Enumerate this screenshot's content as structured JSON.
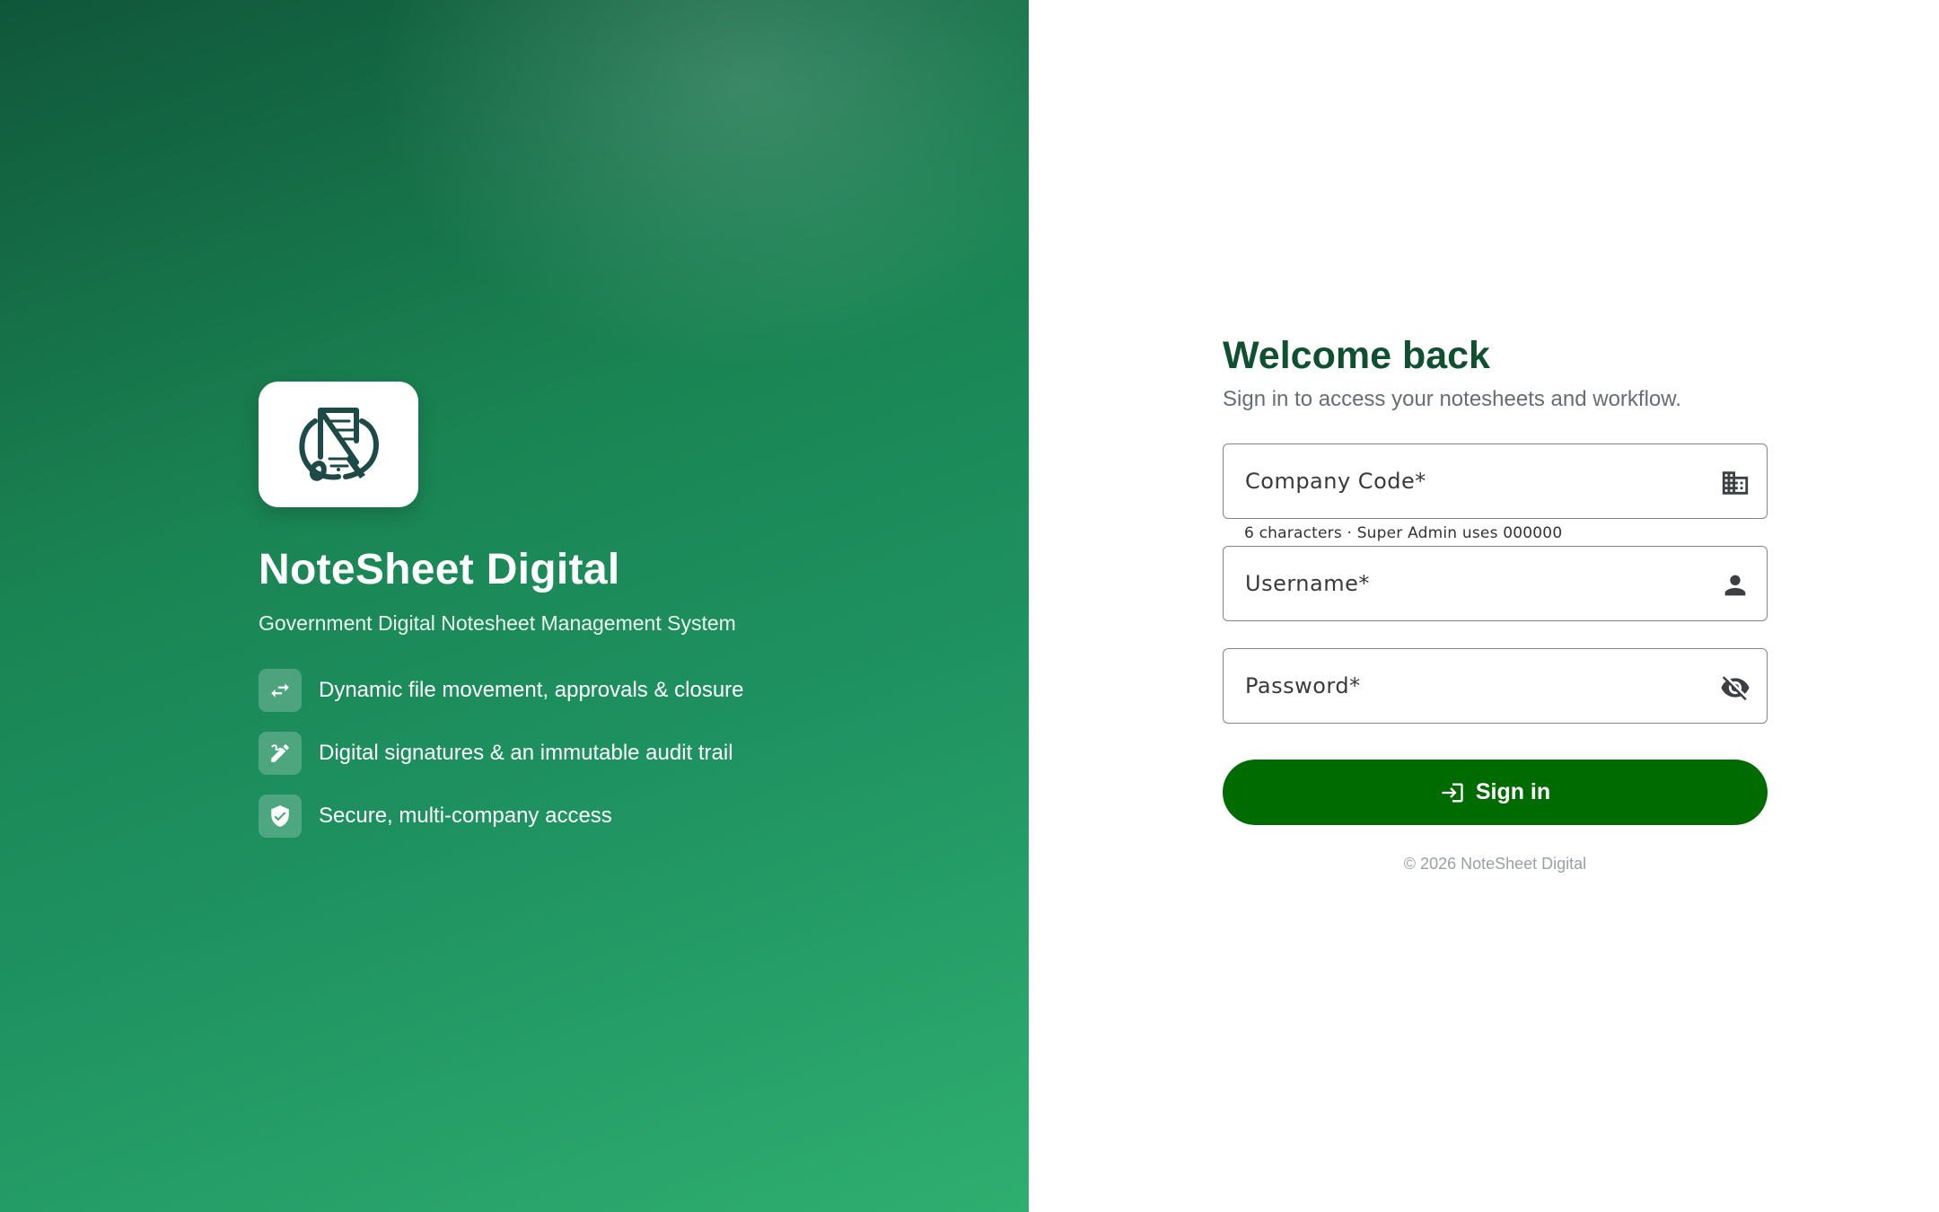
{
  "brand": {
    "logo_icon": "notesheet-logo-icon",
    "title": "NoteSheet Digital",
    "subtitle": "Government Digital Notesheet Management System"
  },
  "features": [
    {
      "icon": "swap-arrows-icon",
      "label": "Dynamic file movement, approvals & closure"
    },
    {
      "icon": "signature-pen-icon",
      "label": "Digital signatures & an immutable audit trail"
    },
    {
      "icon": "shield-check-icon",
      "label": "Secure, multi-company access"
    }
  ],
  "login": {
    "heading": "Welcome back",
    "subheading": "Sign in to access your notesheets and workflow.",
    "company_code": {
      "placeholder": "Company Code*",
      "value": "",
      "icon": "building-icon",
      "helper": "6 characters · Super Admin uses 000000"
    },
    "username": {
      "placeholder": "Username*",
      "value": "",
      "icon": "person-icon"
    },
    "password": {
      "placeholder": "Password*",
      "value": "",
      "icon": "eye-off-icon"
    },
    "submit": {
      "label": "Sign in",
      "icon": "login-icon"
    }
  },
  "footer": "© 2026 NoteSheet Digital",
  "colors": {
    "hero_gradient_start": "#10573a",
    "hero_gradient_end": "#2fae70",
    "heading": "#0e5030",
    "button": "#006b00"
  }
}
